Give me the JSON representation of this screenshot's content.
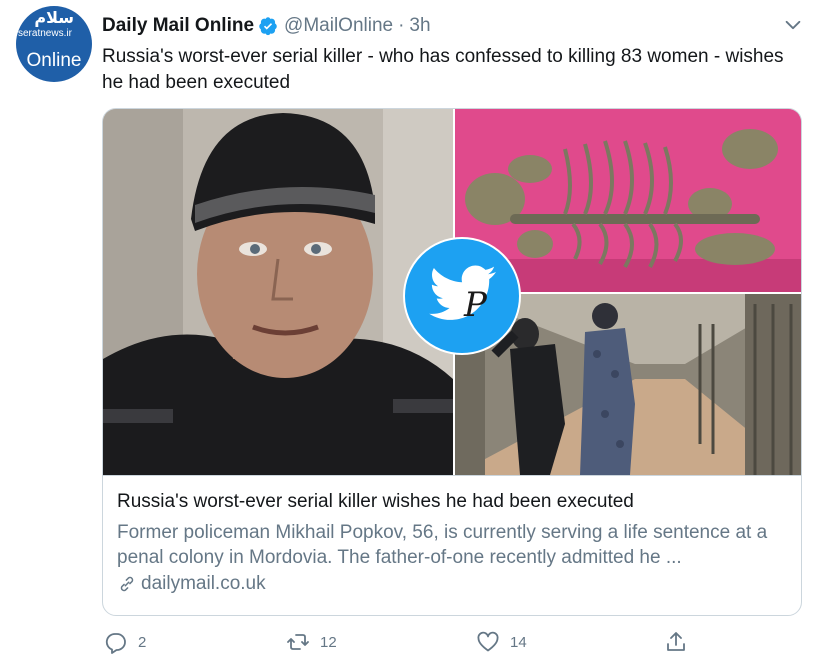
{
  "avatar": {
    "watermark_top": "سلام",
    "watermark_site": "seratnews.ir",
    "label": "Online"
  },
  "tweet": {
    "display_name": "Daily Mail Online",
    "handle": "@MailOnline",
    "separator": "·",
    "time": "3h",
    "text": "Russia's worst-ever serial killer - who has confessed to killing 83 women - wishes he had been executed"
  },
  "card": {
    "title": "Russia's worst-ever serial killer wishes he had been executed",
    "description": "Former policeman Mikhail Popkov, 56, is currently serving a life sentence at a penal colony in Mordovia. The father-of-one recently admitted he ...",
    "domain": "dailymail.co.uk"
  },
  "actions": {
    "replies": "2",
    "retweets": "12",
    "likes": "14"
  },
  "icons": {
    "verified": "verified-badge-icon",
    "caret": "chevron-down-icon",
    "link": "link-icon",
    "reply": "reply-icon",
    "retweet": "retweet-icon",
    "like": "heart-icon",
    "share": "share-icon"
  },
  "colors": {
    "accent": "#1da1f2",
    "text": "#14171a",
    "secondary": "#657786",
    "border": "#ccd6dd"
  }
}
